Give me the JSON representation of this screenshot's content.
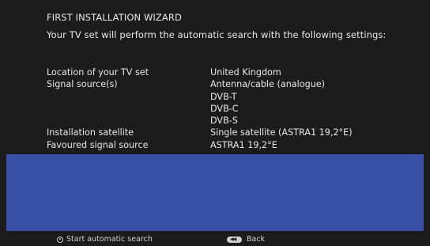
{
  "wizard": {
    "title": "FIRST INSTALLATION WIZARD",
    "subtitle": "Your TV set will perform the automatic search with the following settings:"
  },
  "settings": [
    {
      "label": "Location of your TV set",
      "value": "United Kingdom"
    },
    {
      "label": "Signal source(s)",
      "value": "Antenna/cable (analogue)"
    },
    {
      "label": "",
      "value": "DVB-T"
    },
    {
      "label": "",
      "value": "DVB-C"
    },
    {
      "label": "",
      "value": "DVB-S"
    },
    {
      "label": "Installation satellite",
      "value": "Single satellite (ASTRA1 19,2°E)"
    },
    {
      "label": "Favoured signal source",
      "value": "ASTRA1 19,2°E"
    }
  ],
  "footer": {
    "start_label": "Start automatic search",
    "start_icon": "ok-icon",
    "back_label": "Back",
    "back_icon": "back-button-icon"
  },
  "colors": {
    "background": "#1c1c1c",
    "panel": "#3a4fa6",
    "text": "#e8e8e8"
  }
}
